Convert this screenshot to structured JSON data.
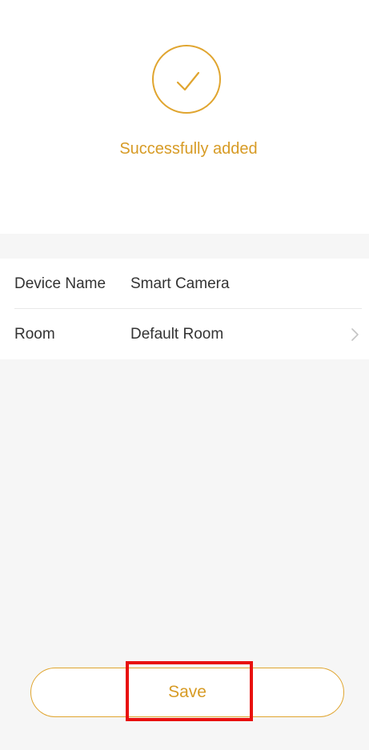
{
  "status": {
    "icon": "check-circle-icon",
    "message": "Successfully added"
  },
  "device_info": {
    "rows": [
      {
        "label": "Device Name",
        "value": "Smart Camera"
      },
      {
        "label": "Room",
        "value": "Default Room",
        "trailing_icon": "chevron-right-icon"
      }
    ]
  },
  "actions": {
    "save_label": "Save"
  },
  "colors": {
    "accent": "#d79b25",
    "highlight": "#e8100e",
    "background": "#f6f6f6"
  }
}
